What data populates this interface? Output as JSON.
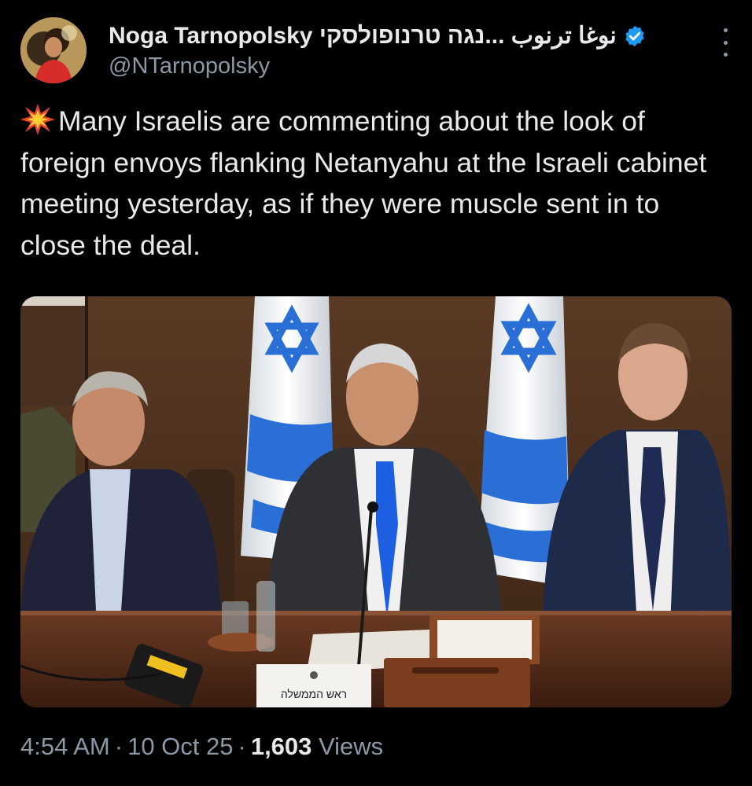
{
  "author": {
    "display_name": "Noga Tarnopolsky نوغا ترنوب ...נגה טרנופולסקי",
    "handle": "@NTarnopolsky",
    "verified": true
  },
  "tweet": {
    "emoji": "collision-emoji",
    "text": "Many Israelis are commenting about the look of foreign envoys flanking Netanyahu at the Israeli cabinet meeting yesterday, as if they were muscle sent in to close the deal.",
    "media_nameplate": "ראש הממשלה"
  },
  "meta": {
    "time": "4:54 AM",
    "date": "10 Oct 25",
    "views_count": "1,603",
    "views_label": "Views"
  },
  "colors": {
    "background": "#000000",
    "text": "#e7e9ea",
    "secondary": "#8b98a5",
    "verified": "#1d9bf0",
    "flag_blue": "#2a6fd6"
  }
}
